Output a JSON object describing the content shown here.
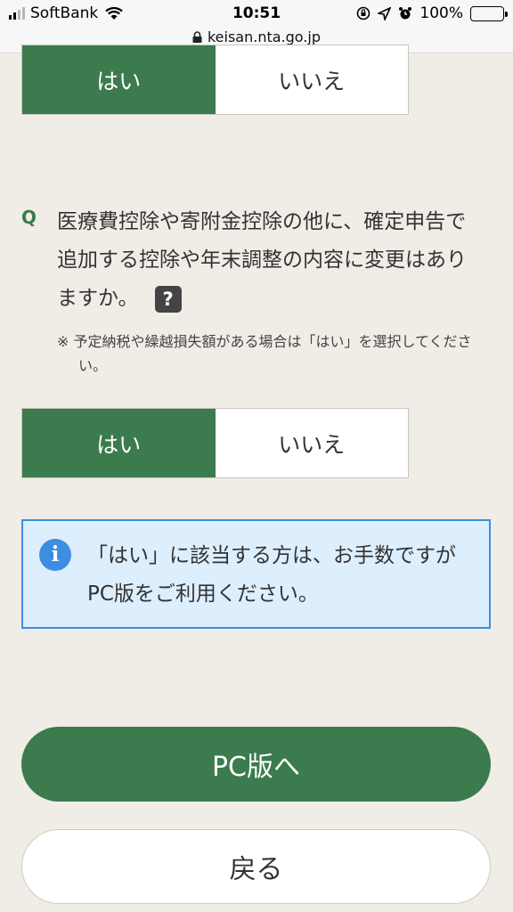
{
  "status_bar": {
    "carrier": "SoftBank",
    "time": "10:51",
    "battery": "100%",
    "url": "keisan.nta.go.jp"
  },
  "top_choice": {
    "yes": "はい",
    "no": "いいえ",
    "selected": "yes"
  },
  "question": {
    "mark": "Q",
    "text": "医療費控除や寄附金控除の他に、確定申告で追加する控除や年末調整の内容に変更はありますか。",
    "help_icon": "?",
    "note": "※ 予定納税や繰越損失額がある場合は「はい」を選択してください。"
  },
  "answer_choice": {
    "yes": "はい",
    "no": "いいえ",
    "selected": "yes"
  },
  "info": {
    "icon": "i",
    "text": "「はい」に該当する方は、お手数ですがPC版をご利用ください。"
  },
  "buttons": {
    "pc_version": "PC版へ",
    "back": "戻る"
  },
  "colors": {
    "accent": "#3b7b4e",
    "info_bg": "#ddeefd",
    "info_border": "#3d8de0",
    "page_bg": "#f0ede6"
  }
}
